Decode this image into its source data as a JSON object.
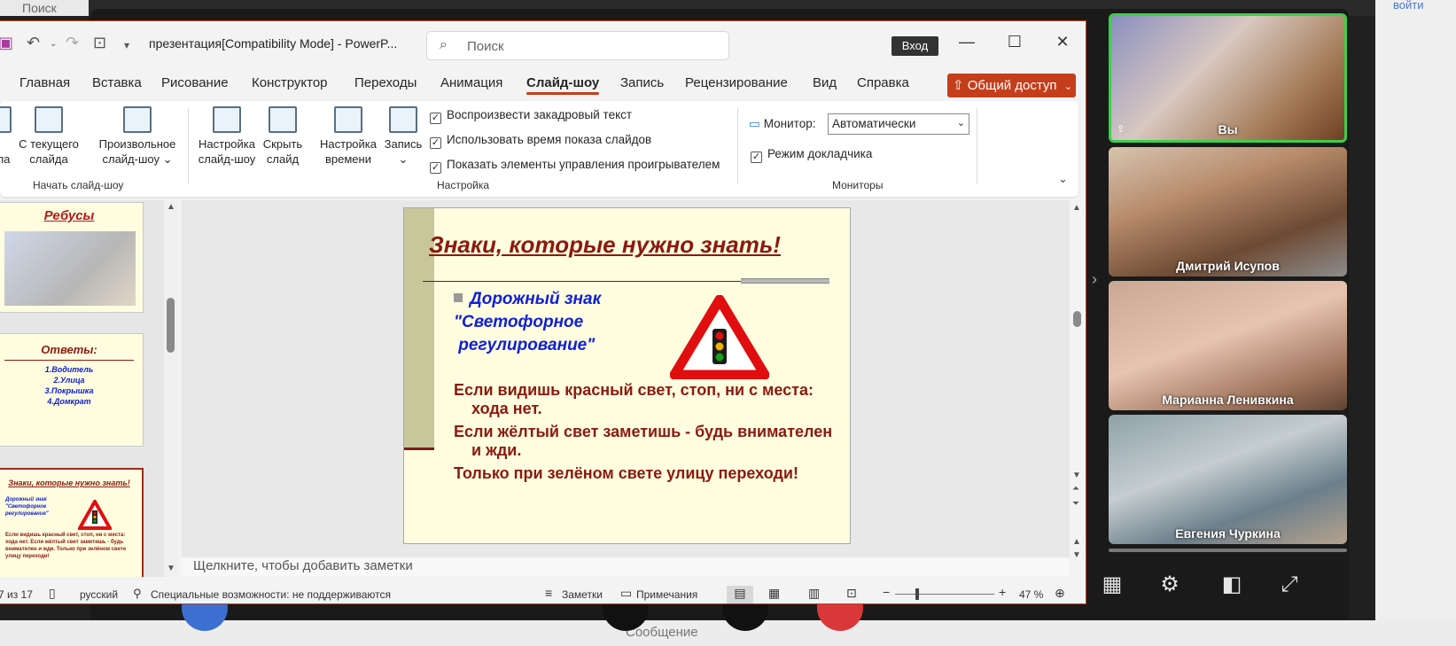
{
  "background": {
    "search_placeholder": "Поиск",
    "right_link": "войти",
    "message_placeholder": "Сообщение"
  },
  "powerpoint": {
    "title": "презентация[Compatibility Mode]  -  PowerP...",
    "search_placeholder": "Поиск",
    "login_button": "Вход",
    "tabs": [
      "Главная",
      "Вставка",
      "Рисование",
      "Конструктор",
      "Переходы",
      "Анимация",
      "Слайд-шоу",
      "Запись",
      "Рецензирование",
      "Вид",
      "Справка"
    ],
    "active_tab": "Слайд-шоу",
    "share_button": "Общий доступ",
    "ribbon": {
      "from_start_partial": "ла",
      "from_current_line1": "С текущего",
      "from_current_line2": "слайда",
      "custom_show_line1": "Произвольное",
      "custom_show_line2": "слайд-шоу",
      "group_start": "Начать слайд-шоу",
      "setup_line1": "Настройка",
      "setup_line2": "слайд-шоу",
      "hide_line1": "Скрыть",
      "hide_line2": "слайд",
      "timing_line1": "Настройка",
      "timing_line2": "времени",
      "record_line1": "Запись",
      "chk_narration": "Воспроизвести закадровый текст",
      "chk_timings": "Использовать время показа слайдов",
      "chk_controls": "Показать элементы управления проигрывателем",
      "group_setup": "Настройка",
      "monitor_label": "Монитор:",
      "monitor_value": "Автоматически",
      "chk_presenter": "Режим докладчика",
      "group_monitors": "Мониторы"
    },
    "thumbnails": {
      "t1_title": "Ребусы",
      "t2_title": "Ответы:",
      "t2_items": [
        "1.Водитель",
        "2.Улица",
        "3.Покрышка",
        "4.Домкрат"
      ],
      "t3_title": "Знаки, которые нужно знать!",
      "t3_sign": "Дорожный знак \"Светофорное регулирование\"",
      "t3_body": "Если видишь красный свет, стоп, ни с места: хода нет. Если жёлтый свет заметишь - будь внимателен и жди. Только при зелёном свете улицу переходи!"
    },
    "slide": {
      "title": "Знаки, которые нужно знать!",
      "sign_line1": "Дорожный знак",
      "sign_line2": "\"Светофорное",
      "sign_line3": " регулирование\"",
      "body1": "Если видишь красный свет, стоп, ни с места: хода нет.",
      "body2": "Если жёлтый свет заметишь - будь внимателен и жди.",
      "body3": "Только при зелёном свете улицу переходи!"
    },
    "notes_placeholder": "Щелкните, чтобы добавить заметки",
    "status": {
      "slide_counter": "7 из 17",
      "language": "русский",
      "accessibility": "Специальные возможности: не поддерживаются",
      "notes": "Заметки",
      "comments": "Примечания",
      "zoom": "47 %",
      "zoom_fraction": 0.47
    }
  },
  "participants": [
    {
      "name": "Вы"
    },
    {
      "name": "Дмитрий Исупов"
    },
    {
      "name": "Марианна Ленивкина"
    },
    {
      "name": "Евгения Чуркина"
    }
  ]
}
